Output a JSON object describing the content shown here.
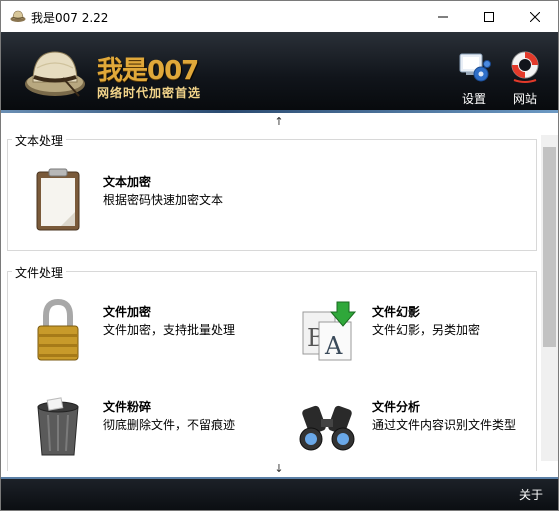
{
  "window": {
    "title": "我是007 2.22",
    "icons": {
      "app": "pith-helmet-icon",
      "minimize": "minimize-icon",
      "maximize": "maximize-icon",
      "close": "close-icon"
    }
  },
  "header": {
    "logo_title": "我是007",
    "logo_subtitle": "网络时代加密首选",
    "tools": [
      {
        "label": "设置",
        "icon": "settings-gears-icon"
      },
      {
        "label": "网站",
        "icon": "lifebuoy-icon"
      }
    ],
    "accent_color": "#e0a83a"
  },
  "content": {
    "scroll_up": "↑",
    "scroll_down": "↓",
    "groups": [
      {
        "label": "文本处理",
        "items": [
          {
            "title": "文本加密",
            "desc": "根据密码快速加密文本",
            "icon": "clipboard-icon"
          }
        ]
      },
      {
        "label": "文件处理",
        "items": [
          {
            "title": "文件加密",
            "desc": "文件加密，支持批量处理",
            "icon": "padlock-icon"
          },
          {
            "title": "文件幻影",
            "desc": "文件幻影，另类加密",
            "icon": "font-swap-icon"
          },
          {
            "title": "文件粉碎",
            "desc": "彻底删除文件，不留痕迹",
            "icon": "trash-can-icon"
          },
          {
            "title": "文件分析",
            "desc": "通过文件内容识别文件类型",
            "icon": "binoculars-icon"
          }
        ]
      }
    ]
  },
  "footer": {
    "about_label": "关于"
  }
}
